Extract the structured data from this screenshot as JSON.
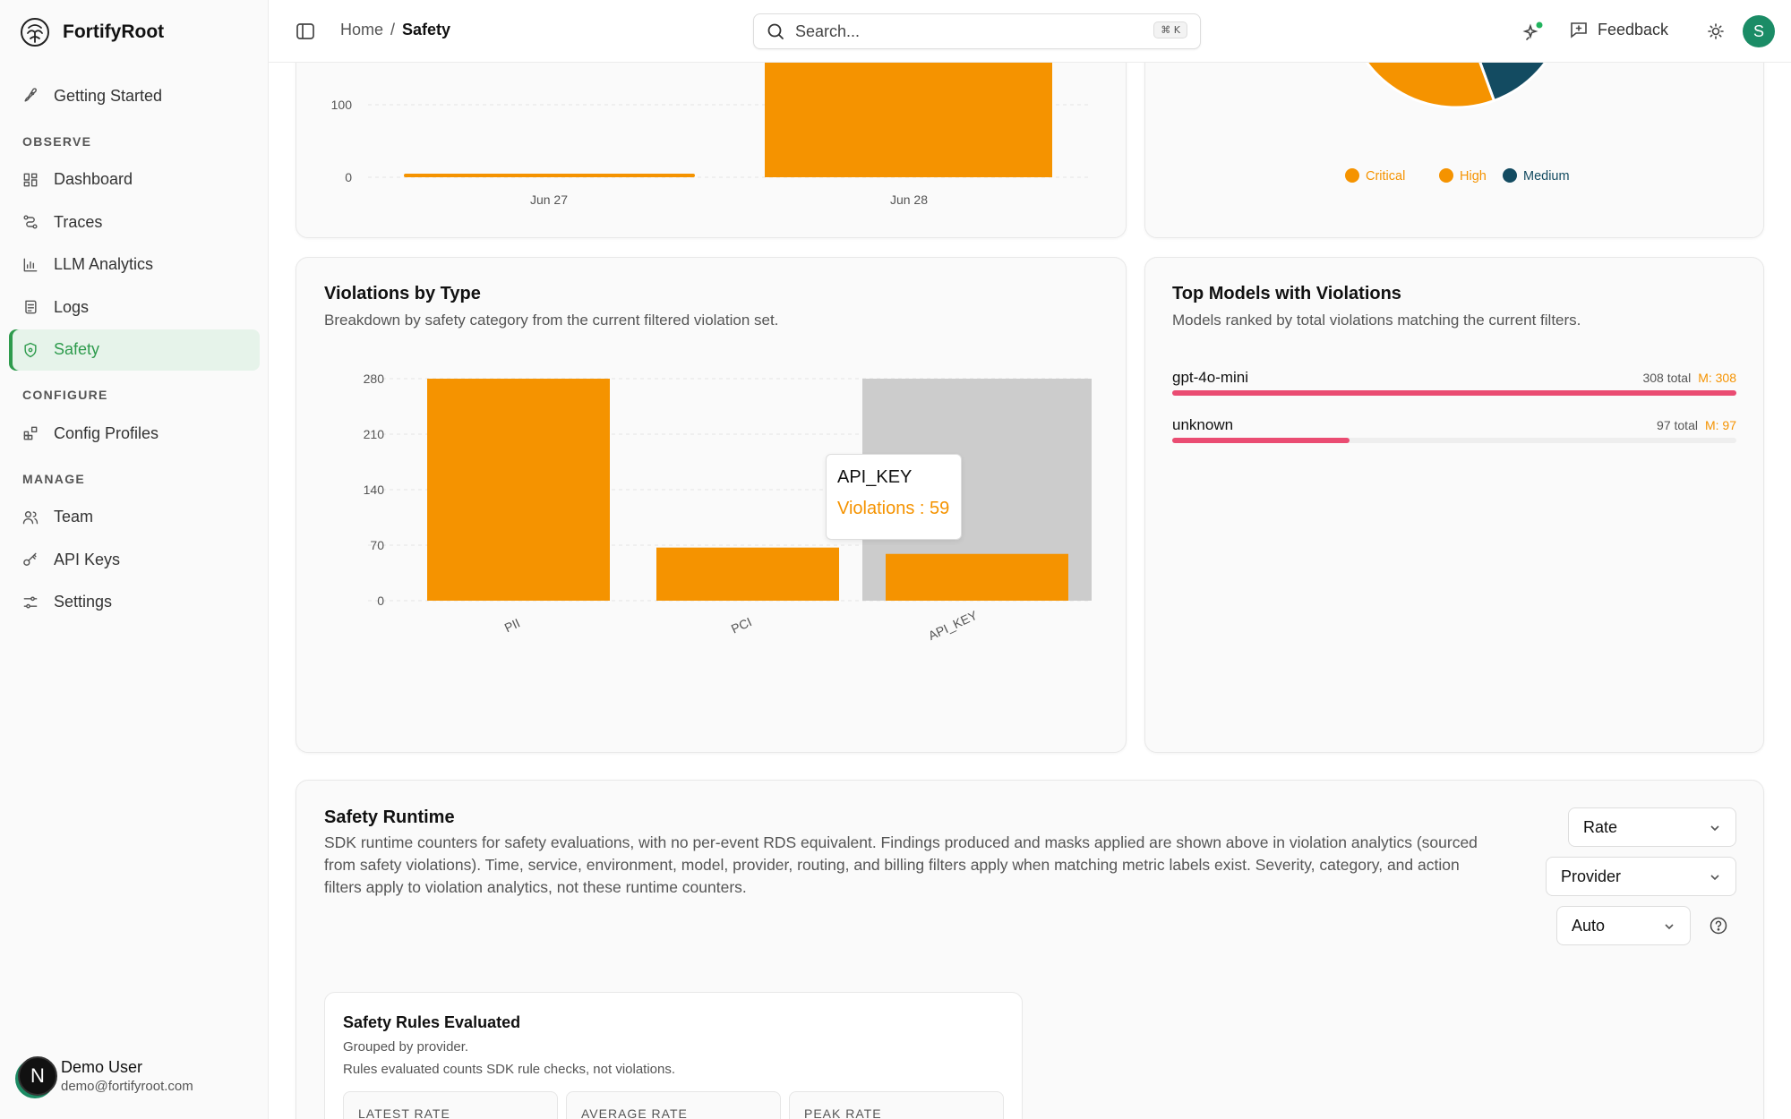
{
  "app": {
    "name": "FortifyRoot"
  },
  "sidebar": {
    "getting_started": "Getting Started",
    "sections": {
      "observe": "OBSERVE",
      "configure": "CONFIGURE",
      "manage": "MANAGE"
    },
    "items": {
      "dashboard": "Dashboard",
      "traces": "Traces",
      "llm_analytics": "LLM Analytics",
      "logs": "Logs",
      "safety": "Safety",
      "config_profiles": "Config Profiles",
      "team": "Team",
      "api_keys": "API Keys",
      "settings": "Settings"
    },
    "active": "Safety",
    "user": {
      "name": "Demo User",
      "email": "demo@fortifyroot.com",
      "initial": "N"
    }
  },
  "topbar": {
    "breadcrumb": {
      "home": "Home",
      "separator": "/",
      "current": "Safety"
    },
    "search": {
      "placeholder": "Search...",
      "shortcut": "⌘ K"
    },
    "feedback_label": "Feedback",
    "avatar_initial": "S"
  },
  "timeline_card": {
    "chart_data": {
      "type": "bar",
      "categories": [
        "Jun 27",
        "Jun 28"
      ],
      "y_ticks": [
        "100",
        "0"
      ],
      "color": "#f59300"
    }
  },
  "severity_card": {
    "chart_data": {
      "type": "pie",
      "legend": [
        {
          "name": "Critical",
          "color": "#f59300"
        },
        {
          "name": "High",
          "color": "#f59300"
        },
        {
          "name": "Medium",
          "color": "#134b61"
        }
      ]
    }
  },
  "violations_by_type": {
    "title": "Violations by Type",
    "description": "Breakdown by safety category from the current filtered violation set.",
    "chart_data": {
      "type": "bar",
      "categories": [
        "PII",
        "PCI",
        "API_KEY"
      ],
      "values": [
        280,
        67,
        59
      ],
      "y_ticks": [
        "280",
        "210",
        "140",
        "70",
        "0"
      ],
      "ylim": [
        0,
        280
      ],
      "color": "#f59300",
      "highlight_color": "#cccccc",
      "highlighted": "API_KEY"
    },
    "tooltip": {
      "label": "API_KEY",
      "value": "Violations : 59"
    }
  },
  "top_models": {
    "title": "Top Models with Violations",
    "description": "Models ranked by total violations matching the current filters.",
    "models": [
      {
        "name": "gpt-4o-mini",
        "total": "308 total",
        "m": "M: 308",
        "fraction": 1.0
      },
      {
        "name": "unknown",
        "total": "97 total",
        "m": "M: 97",
        "fraction": 0.315
      }
    ],
    "bar_color": "#ea4c72"
  },
  "safety_runtime": {
    "title": "Safety Runtime",
    "description_lines": [
      "SDK runtime counters for safety evaluations, with no per-event RDS equivalent. Findings produced and masks applied are shown above in violation analytics (sourced",
      "from safety violations). Time, service, environment, model, provider, routing, and billing filters apply when matching metric labels exist. Severity, category, and action",
      "filters apply to violation analytics, not these runtime counters."
    ],
    "selects": {
      "metric": "Rate",
      "group": "Provider",
      "interval": "Auto"
    },
    "rules_card": {
      "title": "Safety Rules Evaluated",
      "line1": "Grouped by provider.",
      "line2": "Rules evaluated counts SDK rule checks, not violations.",
      "stats": [
        "LATEST RATE",
        "AVERAGE RATE",
        "PEAK RATE"
      ]
    }
  }
}
